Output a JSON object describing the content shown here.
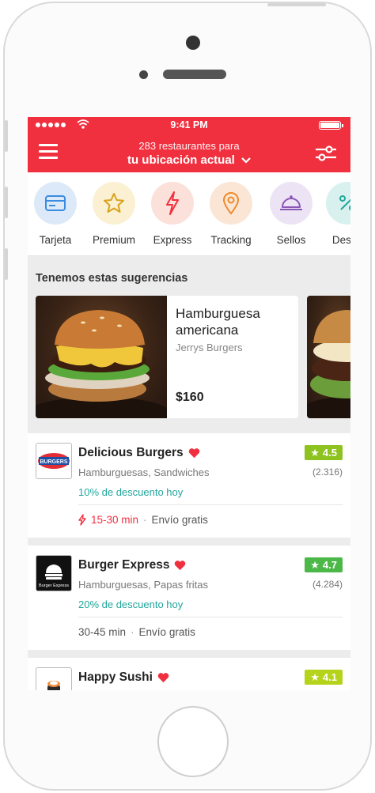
{
  "status_bar": {
    "time": "9:41 PM"
  },
  "header": {
    "restaurant_count": "283 restaurantes para",
    "location": "tu ubicación actual"
  },
  "categories": [
    {
      "label": "Tarjeta",
      "icon": "card-icon",
      "color": "#dce9f8"
    },
    {
      "label": "Premium",
      "icon": "star-icon",
      "color": "#fbf0d2"
    },
    {
      "label": "Express",
      "icon": "bolt-icon",
      "color": "#fbe1d9"
    },
    {
      "label": "Tracking",
      "icon": "location-pin-icon",
      "color": "#fbe6d6"
    },
    {
      "label": "Sellos",
      "icon": "cloche-icon",
      "color": "#ece4f4"
    },
    {
      "label": "Descu",
      "icon": "discount-icon",
      "color": "#d8f1ee"
    }
  ],
  "suggestions": {
    "title": "Tenemos estas sugerencias",
    "items": [
      {
        "name": "Hamburguesa americana",
        "restaurant": "Jerrys Burgers",
        "price": "$160"
      }
    ]
  },
  "restaurants": [
    {
      "name": "Delicious Burgers",
      "categories": "Hamburguesas, Sandwiches",
      "discount": "10% de descuento hoy",
      "delivery_time": "15-30 min",
      "shipping": "Envío gratis",
      "rating": "4.5",
      "reviews": "(2.316)",
      "badge_color": "#8dc21f",
      "logo_text": "BURGERS",
      "favorite": true,
      "express": true
    },
    {
      "name": "Burger Express",
      "categories": "Hamburguesas, Papas fritas",
      "discount": "20% de descuento hoy",
      "delivery_time": "30-45 min",
      "shipping": "Envío gratis",
      "rating": "4.7",
      "reviews": "(4.284)",
      "badge_color": "#4cb848",
      "logo_text": "Burger Express",
      "favorite": true,
      "express": false
    },
    {
      "name": "Happy Sushi",
      "rating": "4.1",
      "badge_color": "#b5d31a",
      "favorite": true
    }
  ],
  "colors": {
    "brand": "#f0303f",
    "discount": "#21a69c"
  }
}
